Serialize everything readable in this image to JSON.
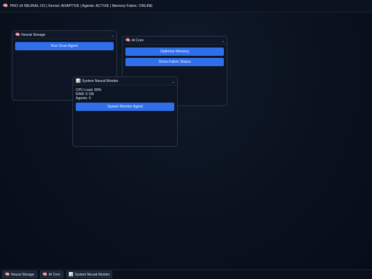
{
  "topbar": {
    "icon": "brain-icon",
    "text": "PRO v9 NEURAL OS | Kernel: ADAPTIVE | Agents: ACTIVE | Memory Fabric: ONLINE"
  },
  "windows": {
    "neural_storage": {
      "icon": "brain-icon",
      "title": "Neural Storage",
      "minimize": "_",
      "buttons": [
        "Run Scan Agent"
      ]
    },
    "ai_core": {
      "icon": "brain-icon",
      "title": "AI Core",
      "minimize": "_",
      "buttons": [
        "Optimize Memory",
        "Show Fabric Status"
      ]
    },
    "system_monitor": {
      "icon": "bar-chart-icon",
      "title": "System Neural Monitor",
      "minimize": "_",
      "stats": [
        "CPU Load: 89%",
        "RAM: 6 GB",
        "Agents: 0"
      ],
      "buttons": [
        "Spawn Monitor Agent"
      ]
    }
  },
  "taskbar": {
    "items": [
      {
        "icon": "brain-icon",
        "label": "Neural Storage"
      },
      {
        "icon": "brain-icon",
        "label": "AI Core"
      },
      {
        "icon": "bar-chart-icon",
        "label": "System Neural Monitor"
      }
    ]
  },
  "colors": {
    "background": "#0b1320",
    "window": "#0d1524",
    "accent_button": "#2f6fea",
    "border": "#2b3446"
  }
}
